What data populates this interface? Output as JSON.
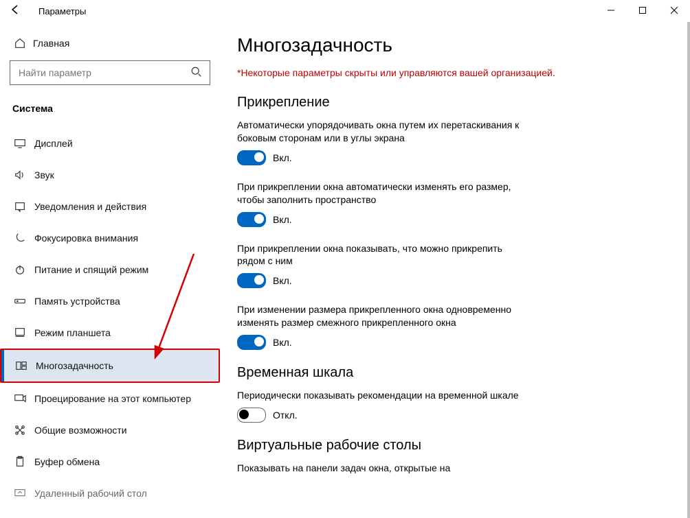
{
  "window": {
    "title": "Параметры"
  },
  "sidebar": {
    "home": "Главная",
    "search_placeholder": "Найти параметр",
    "section": "Система",
    "items": [
      {
        "label": "Дисплей",
        "icon": "display-icon",
        "active": false
      },
      {
        "label": "Звук",
        "icon": "sound-icon",
        "active": false
      },
      {
        "label": "Уведомления и действия",
        "icon": "notifications-icon",
        "active": false
      },
      {
        "label": "Фокусировка внимания",
        "icon": "focus-assist-icon",
        "active": false
      },
      {
        "label": "Питание и спящий режим",
        "icon": "power-icon",
        "active": false
      },
      {
        "label": "Память устройства",
        "icon": "storage-icon",
        "active": false
      },
      {
        "label": "Режим планшета",
        "icon": "tablet-icon",
        "active": false
      },
      {
        "label": "Многозадачность",
        "icon": "multitasking-icon",
        "active": true
      },
      {
        "label": "Проецирование на этот компьютер",
        "icon": "projecting-icon",
        "active": false
      },
      {
        "label": "Общие возможности",
        "icon": "shared-experiences-icon",
        "active": false
      },
      {
        "label": "Буфер обмена",
        "icon": "clipboard-icon",
        "active": false
      },
      {
        "label": "Удаленный рабочий стол",
        "icon": "remote-desktop-icon",
        "active": false
      }
    ]
  },
  "content": {
    "title": "Многозадачность",
    "org_note": "*Некоторые параметры скрыты или управляются вашей организацией.",
    "snap": {
      "heading": "Прикрепление",
      "items": [
        {
          "desc": "Автоматически упорядочивать окна путем их перетаскивания к боковым сторонам или в углы экрана",
          "state": "Вкл.",
          "on": true
        },
        {
          "desc": "При прикреплении окна автоматически изменять его размер, чтобы заполнить пространство",
          "state": "Вкл.",
          "on": true
        },
        {
          "desc": "При прикреплении окна показывать, что можно прикрепить рядом с ним",
          "state": "Вкл.",
          "on": true
        },
        {
          "desc": "При изменении размера прикрепленного окна одновременно изменять размер смежного прикрепленного окна",
          "state": "Вкл.",
          "on": true
        }
      ]
    },
    "timeline": {
      "heading": "Временная шкала",
      "item": {
        "desc": "Периодически показывать рекомендации на временной шкале",
        "state": "Откл.",
        "on": false
      }
    },
    "virtual_desktops": {
      "heading": "Виртуальные рабочие столы",
      "item_desc": "Показывать на панели задач окна, открытые на"
    }
  }
}
